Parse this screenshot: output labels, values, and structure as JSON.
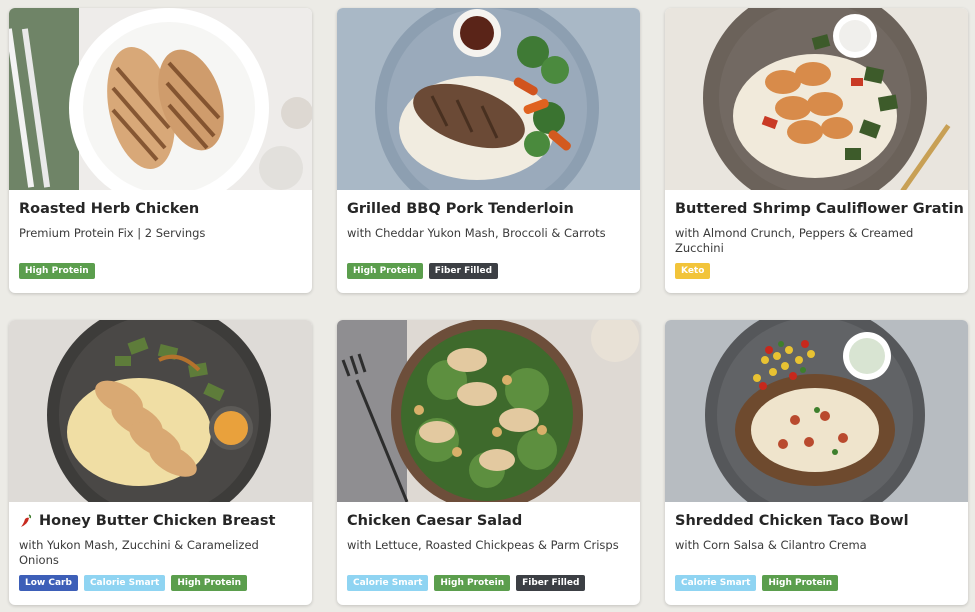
{
  "colors": {
    "high_protein": "#5b9e4d",
    "fiber_filled": "#3c3f44",
    "keto": "#f2c43a",
    "low_carb": "#3d5fb8",
    "calorie_smart": "#8fd4f2"
  },
  "meals": [
    {
      "title": "Roasted Herb Chicken",
      "subtitle": "Premium Protein Fix | 2 Servings",
      "tags": [
        "High Protein"
      ],
      "image": "roasted-herb-chicken-photo"
    },
    {
      "title": "Grilled BBQ Pork Tenderloin",
      "subtitle": "with Cheddar Yukon Mash, Broccoli & Carrots",
      "tags": [
        "High Protein",
        "Fiber Filled"
      ],
      "image": "grilled-bbq-pork-photo"
    },
    {
      "title": "Buttered Shrimp Cauliflower Gratin",
      "subtitle": "with Almond Crunch, Peppers & Creamed Zucchini",
      "tags": [
        "Keto"
      ],
      "image": "buttered-shrimp-photo"
    },
    {
      "title": "Honey Butter Chicken Breast",
      "subtitle": "with Yukon Mash, Zucchini & Caramelized Onions",
      "tags": [
        "Low Carb",
        "Calorie Smart",
        "High Protein"
      ],
      "spicy": true,
      "image": "honey-butter-chicken-photo"
    },
    {
      "title": "Chicken Caesar Salad",
      "subtitle": "with Lettuce, Roasted Chickpeas & Parm Crisps",
      "tags": [
        "Calorie Smart",
        "High Protein",
        "Fiber Filled"
      ],
      "image": "chicken-caesar-salad-photo"
    },
    {
      "title": "Shredded Chicken Taco Bowl",
      "subtitle": "with Corn Salsa & Cilantro Crema",
      "tags": [
        "Calorie Smart",
        "High Protein"
      ],
      "image": "shredded-chicken-taco-photo"
    }
  ]
}
